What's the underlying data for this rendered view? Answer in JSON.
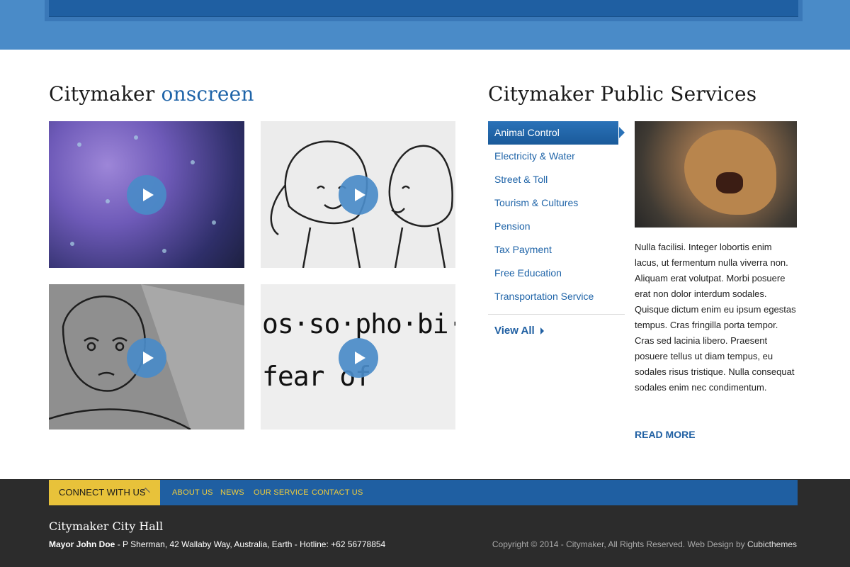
{
  "onscreen": {
    "title_main": "Citymaker",
    "title_accent": "onscreen",
    "videos": [
      {
        "name": "video-rain"
      },
      {
        "name": "video-girls-sketch"
      },
      {
        "name": "video-boy-sketch"
      },
      {
        "name": "video-phobia",
        "text_line1": "os·so·pho·bi·a",
        "text_line2": "fear of"
      }
    ]
  },
  "services": {
    "title": "Citymaker Public Services",
    "items": [
      {
        "label": "Animal Control",
        "active": true
      },
      {
        "label": "Electricity & Water"
      },
      {
        "label": "Street & Toll"
      },
      {
        "label": "Tourism & Cultures"
      },
      {
        "label": "Pension"
      },
      {
        "label": "Tax Payment"
      },
      {
        "label": "Free Education"
      },
      {
        "label": "Transportation Service"
      }
    ],
    "view_all": "View All",
    "description": "Nulla facilisi. Integer lobortis enim lacus, ut fermentum nulla viverra non. Aliquam erat volutpat. Morbi posuere erat non dolor interdum sodales. Quisque dictum enim eu ipsum egestas tempus. Cras fringilla porta tempor. Cras sed lacinia libero. Praesent posuere tellus ut diam tempus, eu sodales risus tristique. Nulla consequat sodales enim nec condimentum.",
    "read_more": "READ MORE"
  },
  "footer": {
    "connect": "CONNECT WITH US",
    "nav": [
      "ABOUT US",
      "NEWS",
      "OUR SERVICE",
      "CONTACT US"
    ],
    "hall_title": "Citymaker City Hall",
    "mayor": "Mayor John Doe",
    "address": " - P Sherman, 42 Wallaby Way, Australia, Earth - Hotline: +62 56778854",
    "copyright": "Copyright © 2014 - Citymaker, All Rights Reserved. Web Design by ",
    "credit": "Cubicthemes"
  },
  "colors": {
    "header_blue": "#4a8bc8",
    "accent_blue": "#1f64a8",
    "footer_dark": "#2c2c2c",
    "connect_yellow": "#e8c23a"
  }
}
